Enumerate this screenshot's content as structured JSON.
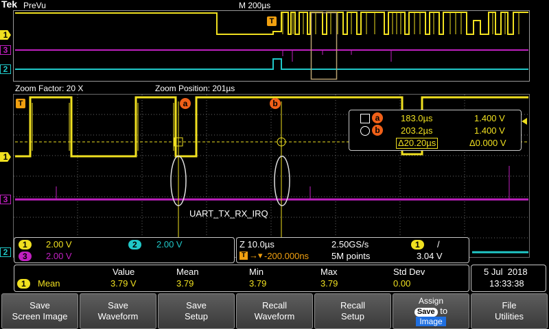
{
  "brand": "Tek",
  "mode": "PreVu",
  "timebase": "M 200µs",
  "zoom": {
    "factor": "Zoom Factor: 20 X",
    "position": "Zoom Position: 201µs"
  },
  "trigger_marker": "T",
  "channel_markers": {
    "ch1": "1",
    "ch3": "3",
    "ch2": "2"
  },
  "cursors": {
    "a_label": "a",
    "b_label": "b",
    "a_time": "183.0µs",
    "a_volt": "1.400 V",
    "b_time": "203.2µs",
    "b_volt": "1.400 V",
    "delta_time": "Δ20.20µs",
    "delta_volt": "Δ0.000 V"
  },
  "annotation": "UART_TX_RX_IRQ",
  "channels": {
    "ch1_label": "1",
    "ch1_scale": "2.00 V",
    "ch2_label": "2",
    "ch2_scale": "2.00 V",
    "ch3_label": "3",
    "ch3_scale": "2.00 V"
  },
  "acquisition": {
    "horizontal": "Z 10.0µs",
    "sample_rate": "2.50GS/s",
    "trigger_pos": "-200.000ns",
    "record_length": "5M points",
    "trig_ch": "1",
    "trig_slope": "/",
    "trig_level": "3.04 V"
  },
  "measurements": {
    "headers": [
      "Value",
      "Mean",
      "Min",
      "Max",
      "Std Dev"
    ],
    "row": {
      "channel": "1",
      "name": "Mean",
      "values": [
        "3.79 V",
        "3.79",
        "3.79",
        "3.79",
        "0.00"
      ]
    }
  },
  "datetime": {
    "date": "5 Jul  2018",
    "time": "13:33:38"
  },
  "menu": [
    {
      "line1": "Save",
      "line2": "Screen Image"
    },
    {
      "line1": "Save",
      "line2": "Waveform"
    },
    {
      "line1": "Save",
      "line2": "Setup"
    },
    {
      "line1": "Recall",
      "line2": "Waveform"
    },
    {
      "line1": "Recall",
      "line2": "Setup"
    },
    {
      "line1": "Assign",
      "chip": "Save",
      "to": "to",
      "image": "Image"
    },
    {
      "line1": "File",
      "line2": "Utilities"
    }
  ],
  "colors": {
    "ch1": "#f0e020",
    "ch2": "#20c8c8",
    "ch3": "#c020c0",
    "cursor": "#f0e020",
    "grid": "#6a6a6a"
  }
}
